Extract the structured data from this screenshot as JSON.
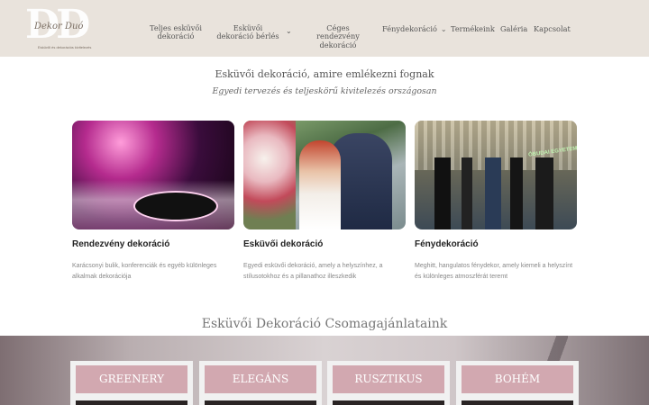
{
  "logo": {
    "monogram": "DD",
    "script": "Dekor Duó",
    "tagline": "Esküvői és dekorációs kivitelezés"
  },
  "nav": {
    "items": [
      {
        "label": "Teljes esküvői dekoráció",
        "has_dropdown": false
      },
      {
        "label": "Esküvői dekoráció bérlés",
        "has_dropdown": true
      },
      {
        "label": "Céges rendezvény dekoráció",
        "has_dropdown": false
      },
      {
        "label": "Fénydekoráció",
        "has_dropdown": true
      },
      {
        "label": "Termékeink",
        "has_dropdown": false
      },
      {
        "label": "Galéria",
        "has_dropdown": false
      },
      {
        "label": "Kapcsolat",
        "has_dropdown": false
      }
    ]
  },
  "hero": {
    "title": "Esküvői dekoráció, amire emlékezni fognak",
    "subtitle": "Egyedi tervezés és teljeskörű kivitelezés országosan"
  },
  "services": [
    {
      "title": "Rendezvény dekoráció",
      "description": "Karácsonyi bulik, konferenciák és egyéb különleges alkalmak dekorációja"
    },
    {
      "title": "Esküvői dekoráció",
      "description": "Egyedi esküvői dekoráció, amely a helyszínhez, a stílusotokhoz és a pillanathoz illeszkedik"
    },
    {
      "title": "Fénydekoráció",
      "description": "Meghitt, hangulatos fénydekor, amely kiemeli a helyszínt és különleges atmoszférát teremt",
      "image_sign": "ÓBUDAI EGYETEM"
    }
  ],
  "packages": {
    "title": "Esküvői Dekoráció Csomagajánlataink",
    "items": [
      "GREENERY",
      "ELEGÁNS",
      "RUSZTIKUS",
      "BOHÉM"
    ]
  },
  "colors": {
    "header_bg": "#e9e3dc",
    "package_label": "#d2a8b0"
  }
}
